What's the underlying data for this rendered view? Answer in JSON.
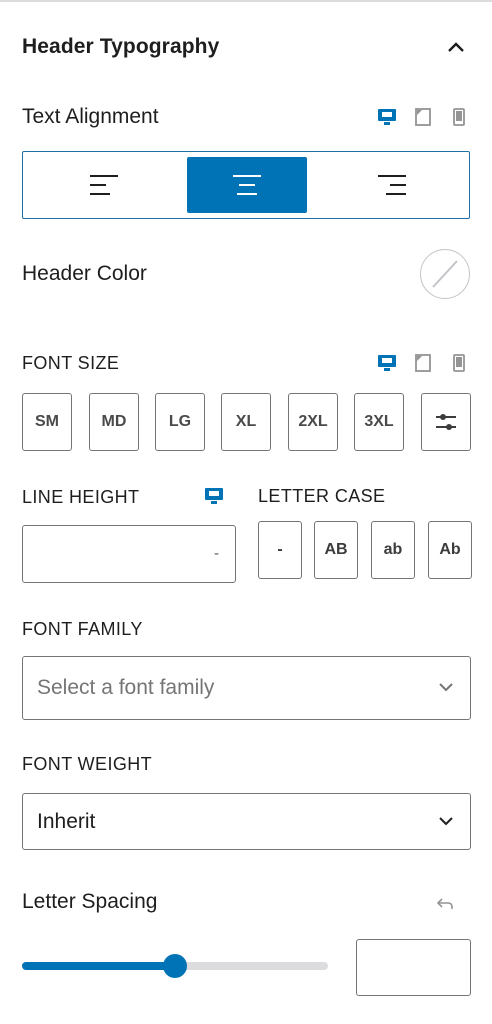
{
  "panel": {
    "title": "Header Typography"
  },
  "text_alignment": {
    "label": "Text Alignment",
    "options": [
      "left-align-icon",
      "center-align-icon",
      "right-align-icon"
    ],
    "selected": "center"
  },
  "header_color": {
    "label": "Header Color"
  },
  "font_size": {
    "label": "FONT SIZE",
    "options": [
      "SM",
      "MD",
      "LG",
      "XL",
      "2XL",
      "3XL"
    ]
  },
  "line_height": {
    "label": "LINE HEIGHT",
    "value": "",
    "unit_placeholder": "-"
  },
  "letter_case": {
    "label": "LETTER CASE",
    "options": [
      "-",
      "AB",
      "ab",
      "Ab"
    ]
  },
  "font_family": {
    "label": "FONT FAMILY",
    "placeholder": "Select a font family"
  },
  "font_weight": {
    "label": "FONT WEIGHT",
    "value": "Inherit"
  },
  "letter_spacing": {
    "label": "Letter Spacing",
    "slider_fraction": 0.5,
    "value": ""
  },
  "colors": {
    "accent": "#0073b6",
    "border": "#757575",
    "muted": "#949494"
  }
}
